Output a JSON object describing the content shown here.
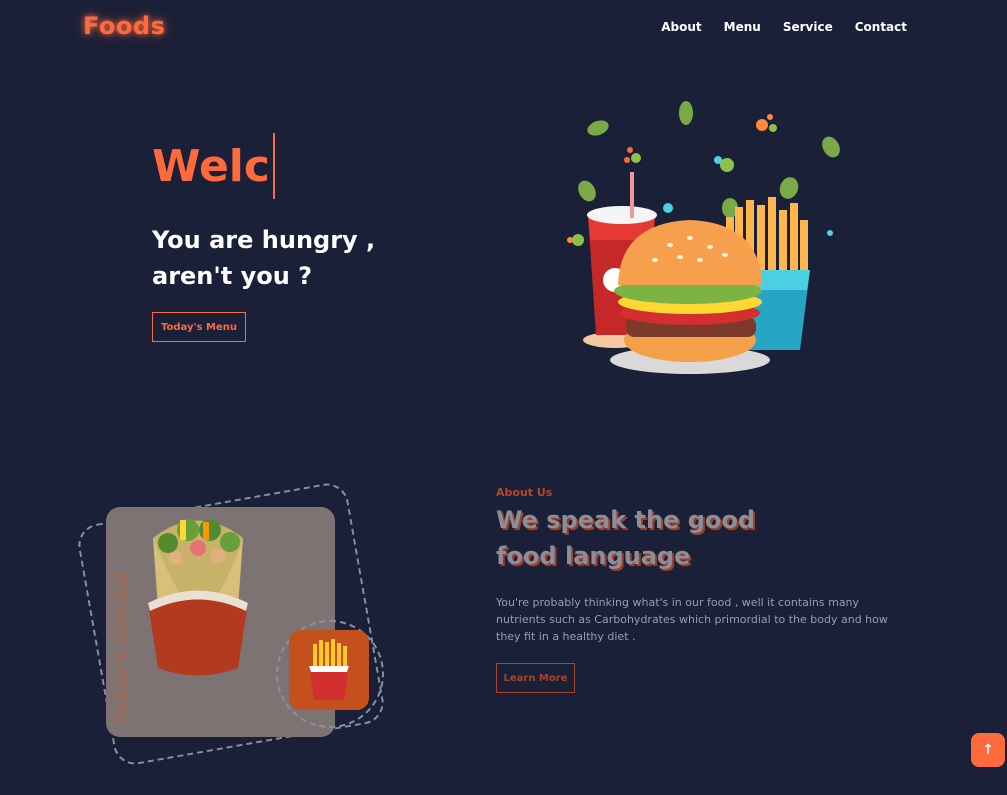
{
  "header": {
    "logo": "Foods",
    "nav": [
      "About",
      "Menu",
      "Service",
      "Contact"
    ]
  },
  "hero": {
    "title": "Welc",
    "subtitle": "You are hungry , aren't you ?",
    "button": "Today's Menu",
    "image_icon": "burger-combo-icon"
  },
  "special": {
    "label": "Today's Special",
    "main_icon": "burrito-icon",
    "side_icon": "fries-icon"
  },
  "about": {
    "tag": "About Us",
    "title": "We speak the good food language",
    "text": "You're probably thinking what's in our food , well it contains many nutrients such as Carbohydrates which primordial to the body and how they fit in a healthy diet .",
    "button": "Learn More"
  },
  "scroll_top": {
    "glyph": "↑"
  },
  "colors": {
    "accent": "#ff6a3d",
    "background": "#1a2037"
  }
}
